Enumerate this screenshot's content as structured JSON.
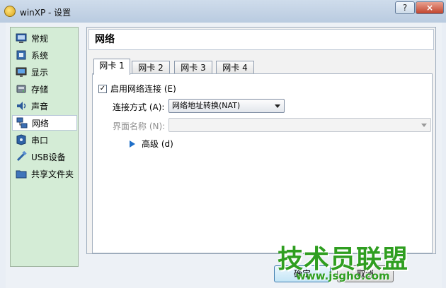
{
  "window": {
    "title": "winXP - 设置",
    "help": "?",
    "close": "×"
  },
  "sidebar": {
    "items": [
      {
        "label": "常规",
        "icon": "monitor-icon"
      },
      {
        "label": "系统",
        "icon": "chip-icon"
      },
      {
        "label": "显示",
        "icon": "display-icon"
      },
      {
        "label": "存储",
        "icon": "disk-icon"
      },
      {
        "label": "声音",
        "icon": "speaker-icon"
      },
      {
        "label": "网络",
        "icon": "network-icon",
        "selected": true
      },
      {
        "label": "串口",
        "icon": "serial-port-icon"
      },
      {
        "label": "USB设备",
        "icon": "usb-icon"
      },
      {
        "label": "共享文件夹",
        "icon": "folder-icon"
      }
    ]
  },
  "panel": {
    "title": "网络",
    "tabs": [
      {
        "label": "网卡 1",
        "active": true
      },
      {
        "label": "网卡 2"
      },
      {
        "label": "网卡 3"
      },
      {
        "label": "网卡 4"
      }
    ],
    "enable_label": "启用网络连接 (E)",
    "enabled": true,
    "attached_label": "连接方式 (A):",
    "attached_value": "网络地址转换(NAT)",
    "name_label": "界面名称 (N):",
    "name_value": "",
    "advanced_label": "高级 (d)"
  },
  "buttons": {
    "ok": "确定",
    "cancel": "取消"
  },
  "watermark": {
    "text": "技术员联盟",
    "url": "www.jsgho.com"
  }
}
